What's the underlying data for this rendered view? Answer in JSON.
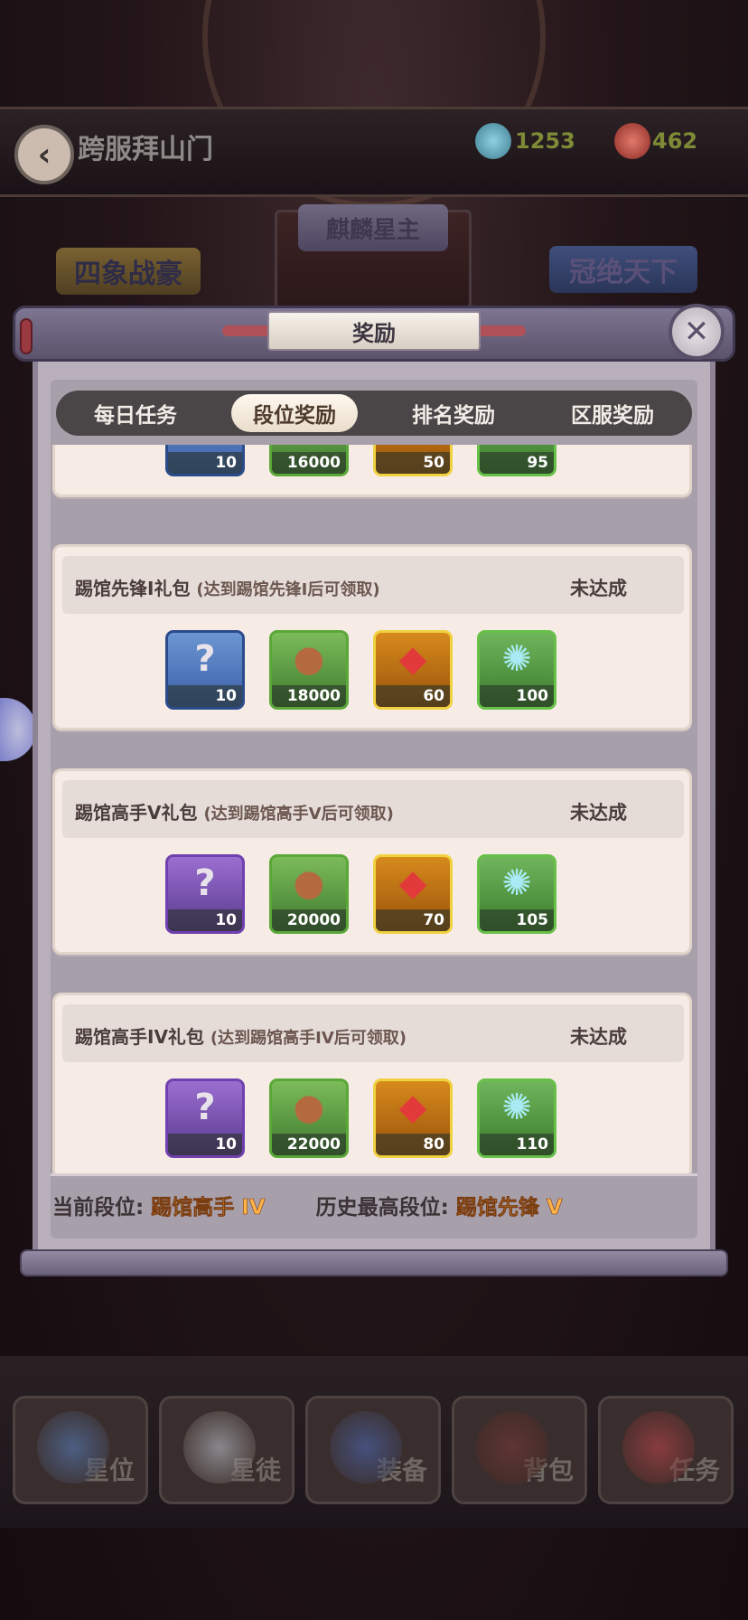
{
  "background": {
    "screen_title": "跨服拜山门",
    "currency_1": "1253",
    "currency_2": "462",
    "ranks": {
      "left": "四象战豪",
      "center": "麒麟星主",
      "right": "冠绝天下"
    },
    "nav": [
      {
        "label": "星位",
        "icon": "star-orbit-icon"
      },
      {
        "label": "星徒",
        "icon": "disciple-icon"
      },
      {
        "label": "装备",
        "icon": "equipment-icon"
      },
      {
        "label": "背包",
        "icon": "backpack-icon"
      },
      {
        "label": "任务",
        "icon": "task-icon"
      }
    ]
  },
  "modal": {
    "title": "奖励",
    "close_icon": "close-icon",
    "tabs": [
      {
        "label": "每日任务",
        "active": false
      },
      {
        "label": "段位奖励",
        "active": true
      },
      {
        "label": "排名奖励",
        "active": false
      },
      {
        "label": "区服奖励",
        "active": false
      }
    ],
    "partial_card_items": [
      "10",
      "16000",
      "50",
      "95"
    ],
    "cards": [
      {
        "title": "踢馆先锋I礼包",
        "subtitle": "(达到踢馆先锋I后可领取)",
        "status": "未达成",
        "items": [
          {
            "icon": "mystery-box-icon",
            "count": "10",
            "rarity": "blue"
          },
          {
            "icon": "copper-coin-icon",
            "count": "18000",
            "rarity": "green"
          },
          {
            "icon": "red-gem-icon",
            "count": "60",
            "rarity": "gold"
          },
          {
            "icon": "jade-icon",
            "count": "100",
            "rarity": "green"
          }
        ]
      },
      {
        "title": "踢馆高手V礼包",
        "subtitle": "(达到踢馆高手V后可领取)",
        "status": "未达成",
        "items": [
          {
            "icon": "mystery-box-icon",
            "count": "10",
            "rarity": "purple"
          },
          {
            "icon": "copper-coin-icon",
            "count": "20000",
            "rarity": "green"
          },
          {
            "icon": "red-gem-icon",
            "count": "70",
            "rarity": "gold"
          },
          {
            "icon": "jade-icon",
            "count": "105",
            "rarity": "green"
          }
        ]
      },
      {
        "title": "踢馆高手IV礼包",
        "subtitle": "(达到踢馆高手IV后可领取)",
        "status": "未达成",
        "items": [
          {
            "icon": "mystery-box-icon",
            "count": "10",
            "rarity": "purple"
          },
          {
            "icon": "copper-coin-icon",
            "count": "22000",
            "rarity": "green"
          },
          {
            "icon": "red-gem-icon",
            "count": "80",
            "rarity": "gold"
          },
          {
            "icon": "jade-icon",
            "count": "110",
            "rarity": "green"
          }
        ]
      }
    ],
    "footer": {
      "current_label": "当前段位:",
      "current_value": "踢馆高手 IV",
      "best_label": "历史最高段位:",
      "best_value": "踢馆先锋 V"
    }
  },
  "colors": {
    "accent_orange": "#ffb34a",
    "panel": "#f6ece5",
    "tab_active": "#fff8ee"
  }
}
